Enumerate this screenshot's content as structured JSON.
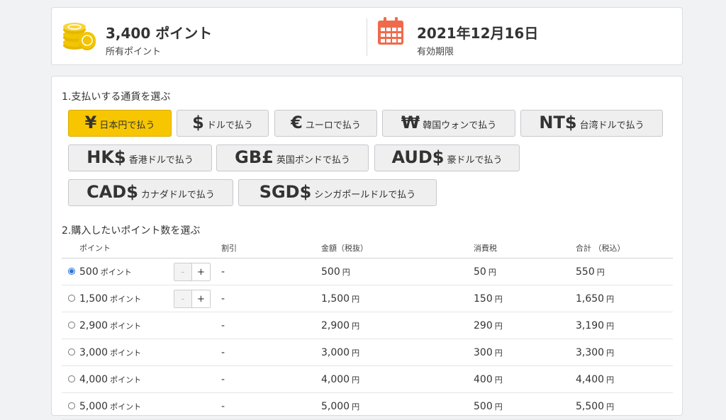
{
  "summary": {
    "points_value": "3,400 ポイント",
    "points_label": "所有ポイント",
    "expiry_value": "2021年12月16日",
    "expiry_label": "有効期限"
  },
  "section1_title": "1.支払いする通貨を選ぶ",
  "currencies": [
    {
      "symbol": "¥",
      "label": "日本円で払う",
      "selected": true
    },
    {
      "symbol": "$",
      "label": "ドルで払う"
    },
    {
      "symbol": "€",
      "label": "ユーロで払う"
    },
    {
      "symbol": "₩",
      "label": "韓国ウォンで払う"
    },
    {
      "symbol": "NT$",
      "label": "台湾ドルで払う"
    },
    {
      "symbol": "HK$",
      "label": "香港ドルで払う"
    },
    {
      "symbol": "GB£",
      "label": "英国ポンドで払う"
    },
    {
      "symbol": "AUD$",
      "label": "豪ドルで払う"
    },
    {
      "symbol": "CAD$",
      "label": "カナダドルで払う"
    },
    {
      "symbol": "SGD$",
      "label": "シンガポールドルで払う"
    }
  ],
  "section2_title": "2.購入したいポイント数を選ぶ",
  "table": {
    "headers": [
      "ポイント",
      "割引",
      "金額（税抜）",
      "消費税",
      "合計 （税込）"
    ],
    "point_unit": "ポイント",
    "yen_unit": "円",
    "stepper_minus": "-",
    "stepper_plus": "+",
    "rows": [
      {
        "points": "500",
        "discount": "-",
        "price": "500",
        "tax": "50",
        "total": "550",
        "selected": true,
        "stepper": true
      },
      {
        "points": "1,500",
        "discount": "-",
        "price": "1,500",
        "tax": "150",
        "total": "1,650",
        "stepper": true
      },
      {
        "points": "2,900",
        "discount": "-",
        "price": "2,900",
        "tax": "290",
        "total": "3,190"
      },
      {
        "points": "3,000",
        "discount": "-",
        "price": "3,000",
        "tax": "300",
        "total": "3,300"
      },
      {
        "points": "4,000",
        "discount": "-",
        "price": "4,000",
        "tax": "400",
        "total": "4,400"
      },
      {
        "points": "5,000",
        "discount": "-",
        "price": "5,000",
        "tax": "500",
        "total": "5,500"
      }
    ]
  },
  "colors": {
    "accent": "#f7c600",
    "coin": "#f2c500",
    "calendar": "#ef6a4c",
    "radio": "#2b74d6"
  }
}
